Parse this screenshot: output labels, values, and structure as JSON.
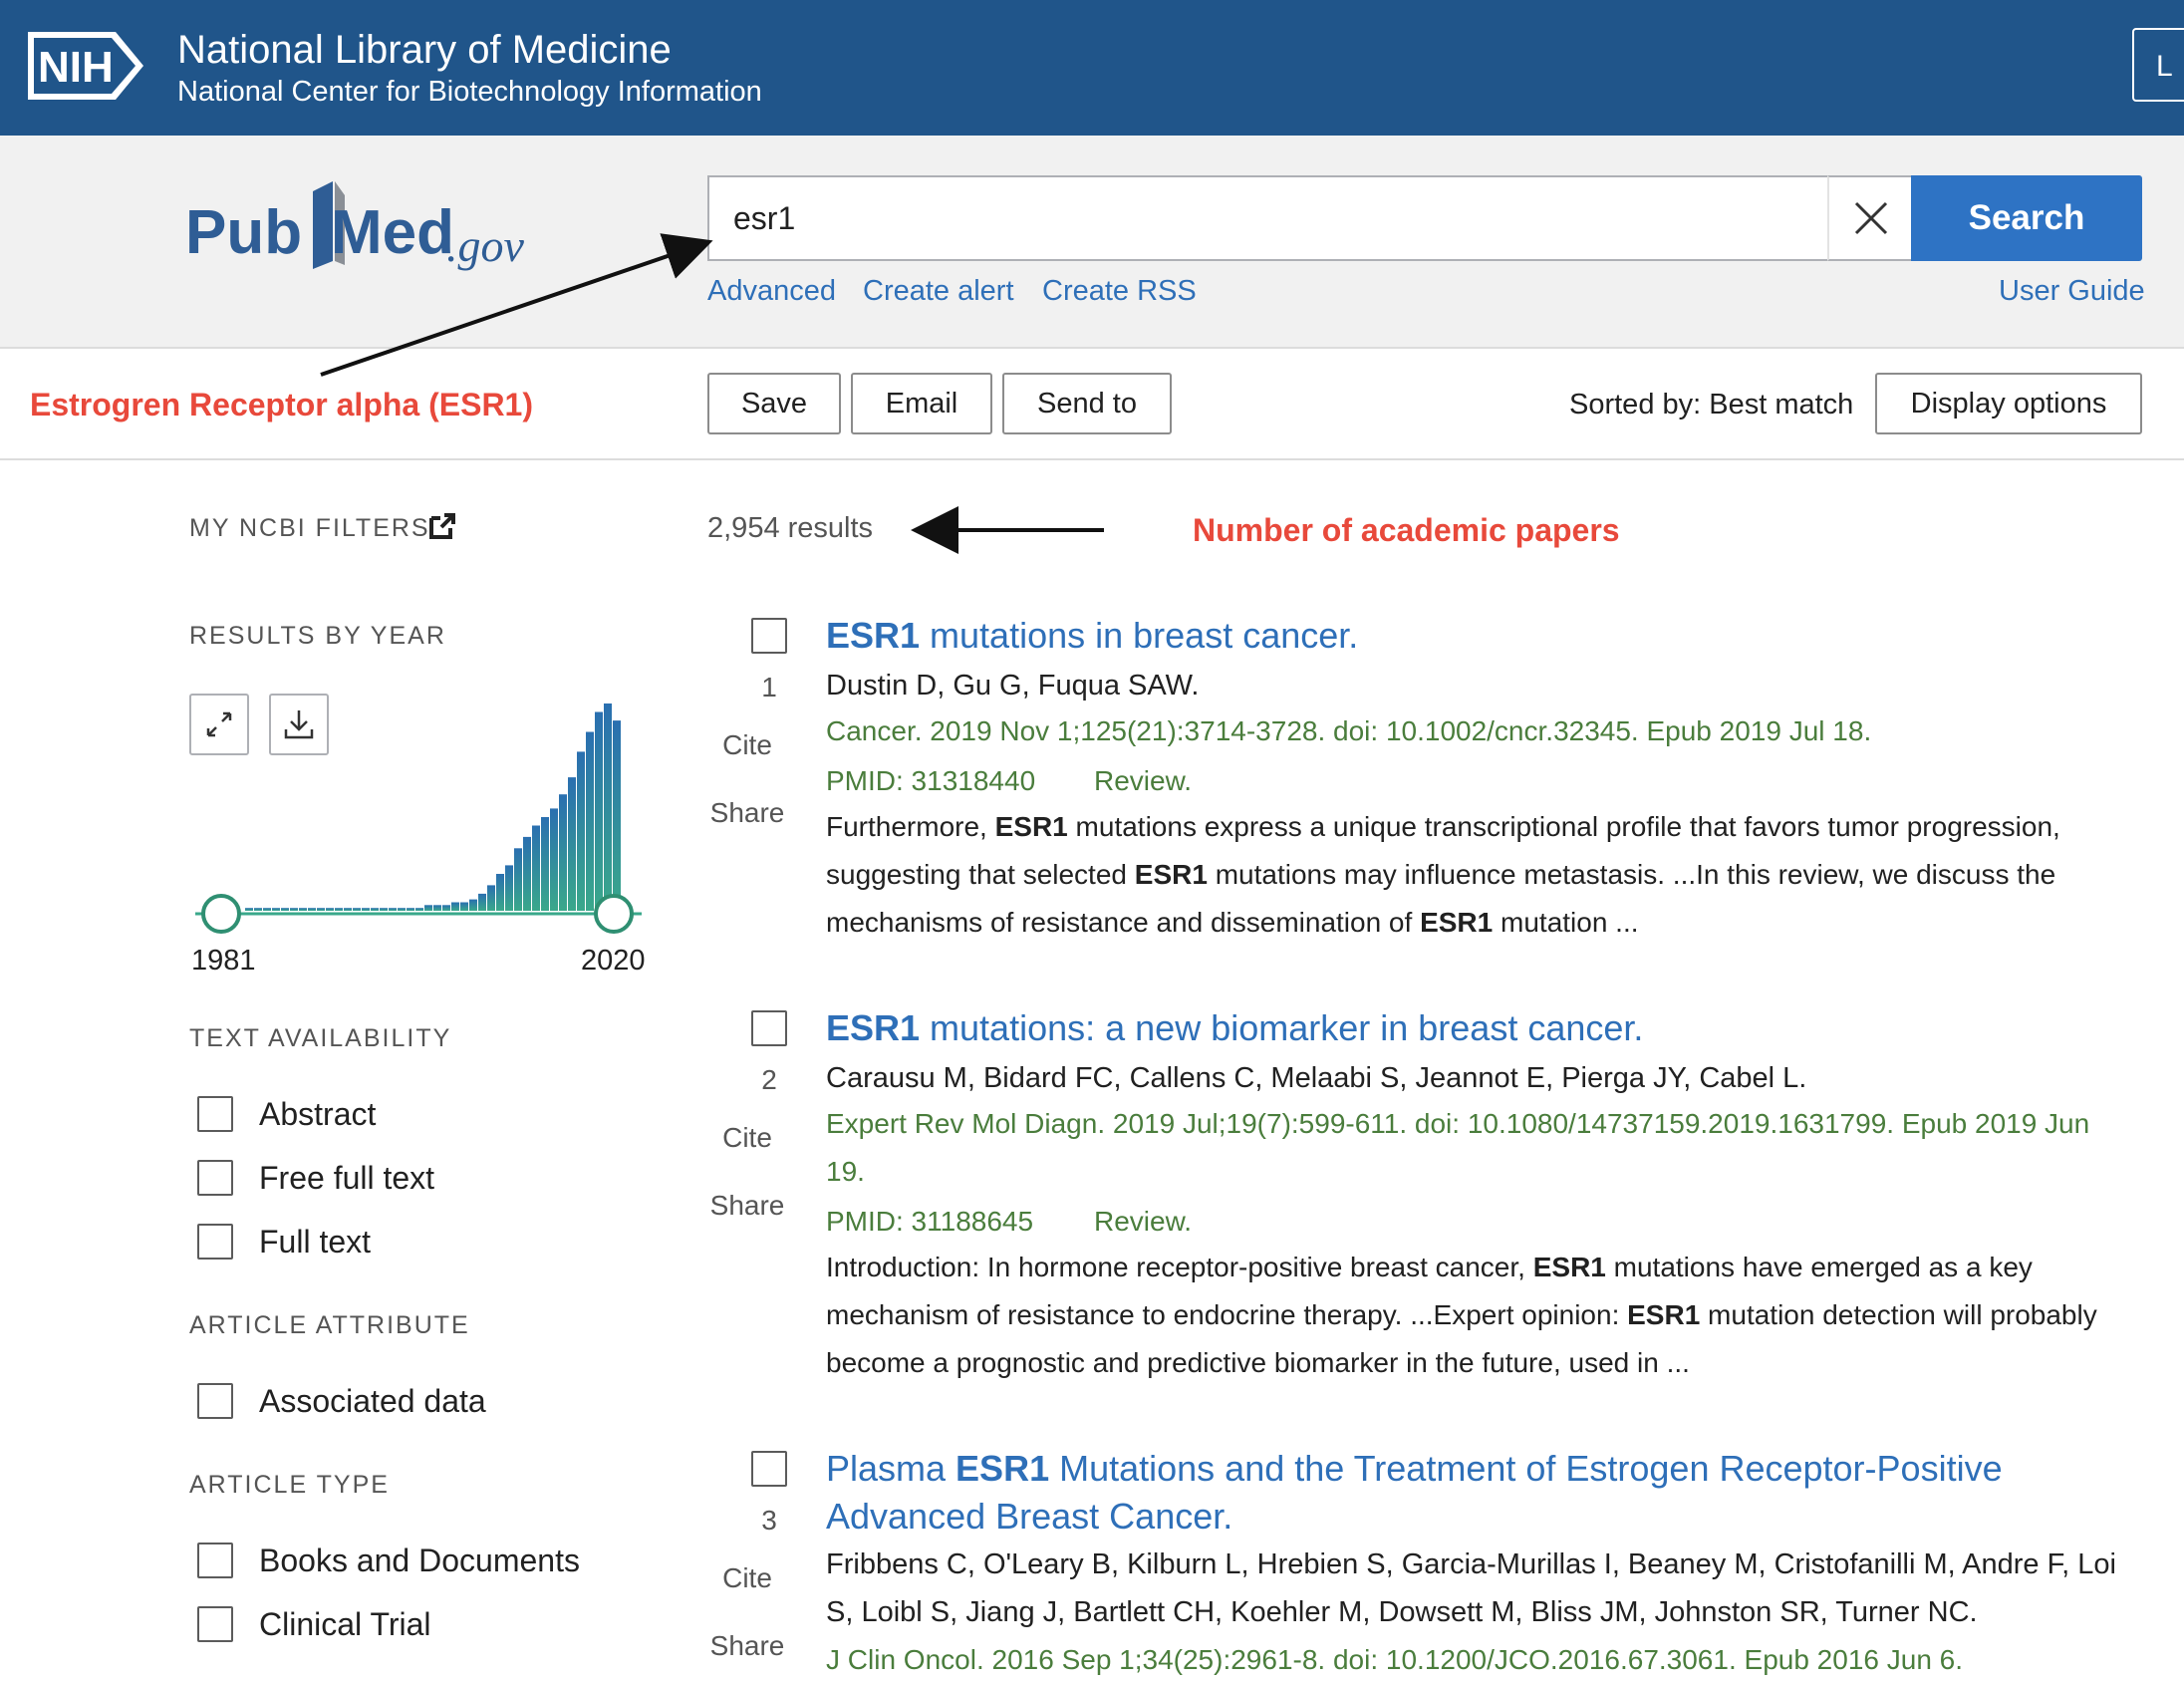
{
  "header": {
    "logo_text": "NIH",
    "title": "National Library of Medicine",
    "subtitle": "National Center for Biotechnology Information",
    "login_label": "L"
  },
  "search": {
    "logo_pub": "Pub",
    "logo_med": "Med",
    "logo_gov": ".gov",
    "query": "esr1",
    "button_label": "Search",
    "links": [
      "Advanced",
      "Create alert",
      "Create RSS"
    ],
    "user_guide": "User Guide"
  },
  "annotations": {
    "search_term": "Estrogren Receptor alpha (ESR1)",
    "results_count": "Number of academic papers"
  },
  "toolbar": {
    "save": "Save",
    "email": "Email",
    "send_to": "Send to",
    "sorted_by": "Sorted by: Best match",
    "display_options": "Display options"
  },
  "sidebar": {
    "my_filters": "MY NCBI FILTERS",
    "results_by_year": "RESULTS BY YEAR",
    "year_start": "1981",
    "year_end": "2020",
    "text_availability": "TEXT AVAILABILITY",
    "text_filters": [
      "Abstract",
      "Free full text",
      "Full text"
    ],
    "article_attribute": "ARTICLE ATTRIBUTE",
    "attribute_filters": [
      "Associated data"
    ],
    "article_type": "ARTICLE TYPE",
    "type_filters": [
      "Books and Documents",
      "Clinical Trial"
    ]
  },
  "year_histogram": {
    "values": [
      1,
      1,
      1,
      1,
      1,
      1,
      1,
      1,
      1,
      1,
      1,
      1,
      1,
      1,
      1,
      1,
      1,
      1,
      1,
      1,
      2,
      2,
      2,
      3,
      3,
      4,
      6,
      9,
      13,
      16,
      22,
      26,
      30,
      33,
      36,
      41,
      47,
      56,
      63,
      70,
      73,
      67
    ]
  },
  "results": {
    "count_text": "2,954 results",
    "cite": "Cite",
    "share": "Share",
    "items": [
      {
        "num": "1",
        "title_bold": "ESR1",
        "title_rest": " mutations in breast cancer.",
        "authors": "Dustin D, Gu G, Fuqua SAW.",
        "journal": "Cancer. 2019 Nov 1;125(21):3714-3728. doi: 10.1002/cncr.32345. Epub 2019 Jul 18.",
        "pmid": "PMID: 31318440",
        "type": "Review.",
        "snippet": [
          "Furthermore, ",
          "ESR1",
          " mutations express a unique transcriptional profile that favors tumor progression, suggesting that selected ",
          "ESR1",
          " mutations may influence metastasis. ...In this review, we discuss the mechanisms of resistance and dissemination of ",
          "ESR1",
          " mutation ..."
        ]
      },
      {
        "num": "2",
        "title_bold": "ESR1",
        "title_rest": " mutations: a new biomarker in breast cancer.",
        "authors": "Carausu M, Bidard FC, Callens C, Melaabi S, Jeannot E, Pierga JY, Cabel L.",
        "journal": "Expert Rev Mol Diagn. 2019 Jul;19(7):599-611. doi: 10.1080/14737159.2019.1631799. Epub 2019 Jun 19.",
        "pmid": "PMID: 31188645",
        "type": "Review.",
        "snippet": [
          "Introduction: In hormone receptor-positive breast cancer, ",
          "ESR1",
          " mutations have emerged as a key mechanism of resistance to endocrine therapy. ...Expert opinion: ",
          "ESR1",
          " mutation detection will probably become a prognostic and predictive biomarker in the future, used in ..."
        ]
      },
      {
        "num": "3",
        "title_pre": "Plasma ",
        "title_bold": "ESR1",
        "title_rest": " Mutations and the Treatment of Estrogen Receptor-Positive Advanced Breast Cancer.",
        "authors": "Fribbens C, O'Leary B, Kilburn L, Hrebien S, Garcia-Murillas I, Beaney M, Cristofanilli M, Andre F, Loi S, Loibl S, Jiang J, Bartlett CH, Koehler M, Dowsett M, Bliss JM, Johnston SR, Turner NC.",
        "journal": "J Clin Oncol. 2016 Sep 1;34(25):2961-8. doi: 10.1200/JCO.2016.67.3061. Epub 2016 Jun 6."
      }
    ]
  },
  "colors": {
    "nih_blue": "#20558a",
    "link_blue": "#2e6fb8",
    "search_blue": "#2e73c4",
    "annotation_red": "#e8493b",
    "journal_green": "#4a7d3c",
    "histogram_green": "#3aa88b",
    "histogram_blue": "#2a6fb0"
  }
}
